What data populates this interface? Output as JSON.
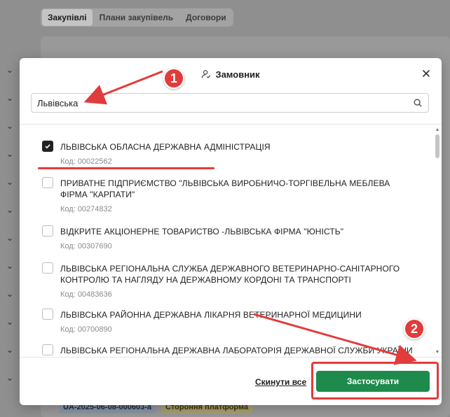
{
  "background": {
    "tabs": [
      {
        "label": "Закупівлі",
        "active": true
      },
      {
        "label": "Плани закупівель",
        "active": false
      },
      {
        "label": "Договори",
        "active": false
      }
    ],
    "badges": [
      {
        "label": "UA-2025-06-08-000603-a",
        "style": "blue"
      },
      {
        "label": "Стороння платформа",
        "style": "yellow"
      }
    ]
  },
  "modal": {
    "title": "Замовник",
    "title_icon": "user-check-icon",
    "close_icon": "close-icon",
    "search": {
      "value": "Львівська",
      "icon": "search-icon"
    },
    "items": [
      {
        "name": "ЛЬВІВСЬКА ОБЛАСНА ДЕРЖАВНА АДМІНІСТРАЦІЯ",
        "code": "Код: 00022562",
        "checked": true
      },
      {
        "name": "ПРИВАТНЕ ПІДПРИЄМСТВО \"ЛЬВІВСЬКА ВИРОБНИЧО-ТОРГІВЕЛЬНА МЕБЛЕВА ФІРМА \"КАРПАТИ\"",
        "code": "Код: 00274832",
        "checked": false
      },
      {
        "name": "ВІДКРИТЕ АКЦІОНЕРНЕ ТОВАРИСТВО -ЛЬВІВСЬКА ФІРМА \"ЮНІСТЬ\"",
        "code": "Код: 00307690",
        "checked": false
      },
      {
        "name": "ЛЬВІВСЬКА РЕГІОНАЛЬНА СЛУЖБА ДЕРЖАВНОГО ВЕТЕРИНАРНО-САНІТАРНОГО КОНТРОЛЮ ТА НАГЛЯДУ НА ДЕРЖАВНОМУ КОРДОНІ ТА ТРАНСПОРТІ",
        "code": "Код: 00483636",
        "checked": false
      },
      {
        "name": "ЛЬВІВСЬКА РАЙОННА ДЕРЖАВНА ЛІКАРНЯ ВЕТЕРИНАРНОЇ МЕДИЦИНИ",
        "code": "Код: 00700890",
        "checked": false
      },
      {
        "name": "ЛЬВІВСЬКА РЕГІОНАЛЬНА ДЕРЖАВНА ЛАБОРАТОРІЯ ДЕРЖАВНОЇ СЛУЖБИ УКРАЇНИ",
        "code": "",
        "checked": false
      }
    ],
    "reset_label": "Скинути все",
    "apply_label": "Застосувати"
  },
  "annotations": {
    "step1": "1",
    "step2": "2"
  },
  "colors": {
    "accent_green": "#1e8a4c",
    "annotation_red": "#e23b3b"
  }
}
